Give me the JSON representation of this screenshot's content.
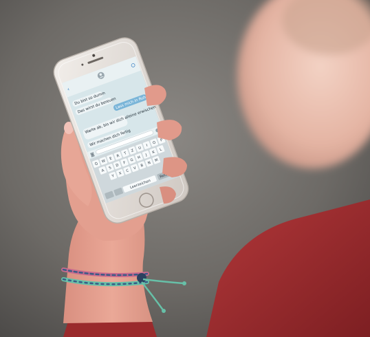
{
  "colors": {
    "background": "#6f6c68",
    "skin": "#e8a79a",
    "sweater": "#9a2a2c",
    "phone_body": "#e7e2dd",
    "screen": "#d7e6ea",
    "bubble_incoming": "#eef4f6",
    "bubble_outgoing": "#7ab5d8",
    "bracelet_blue": "#3a5b86",
    "bracelet_green": "#67c0a8",
    "bracelet_pink": "#c86b8e"
  },
  "phone": {
    "messages": [
      {
        "side": "incoming",
        "text": "Du bist so dumm"
      },
      {
        "side": "incoming",
        "text": "Das wirst du bereuen"
      },
      {
        "side": "outgoing",
        "text": "Lass mich in Ruhe"
      },
      {
        "side": "incoming",
        "text": "Warte ab, bis wir dich alleine erwischen"
      },
      {
        "side": "incoming",
        "text": "Wir machen dich fertig"
      }
    ],
    "keyboard_rows": [
      [
        "Q",
        "W",
        "E",
        "R",
        "T",
        "Z",
        "U",
        "I",
        "O",
        "P"
      ],
      [
        "A",
        "S",
        "D",
        "F",
        "G",
        "H",
        "J",
        "K",
        "L"
      ],
      [
        "Y",
        "X",
        "C",
        "V",
        "B",
        "N",
        "M"
      ]
    ],
    "space_label": "Leerzeichen",
    "return_label": "Return"
  },
  "icons": {
    "back": "chevron-left-icon",
    "contact": "avatar-icon",
    "info": "info-icon",
    "camera": "camera-icon",
    "home": "home-button-icon"
  }
}
